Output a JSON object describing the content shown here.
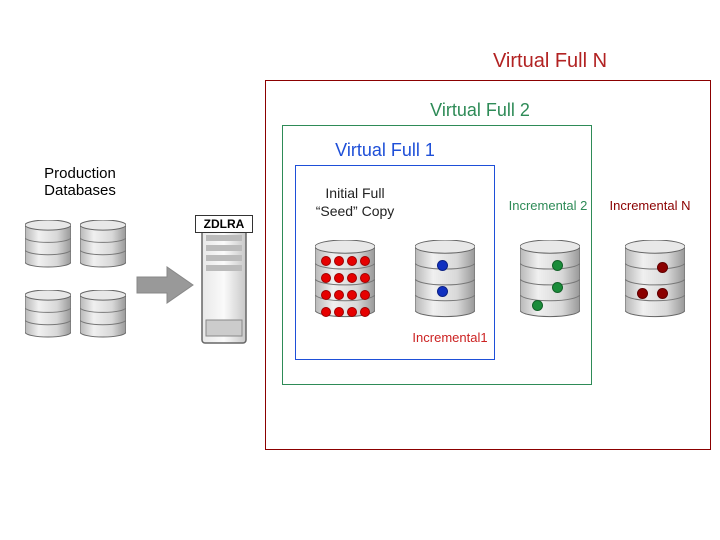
{
  "labels": {
    "production": "Production\nDatabases",
    "zdlra": "ZDLRA",
    "virtualN": "Virtual Full N",
    "virtual2": "Virtual Full 2",
    "virtual1": "Virtual Full 1",
    "seed1": "Initial Full",
    "seed2": "“Seed” Copy",
    "inc1": "Incremental1",
    "inc2": "Incremental 2",
    "incN": "Incremental N"
  },
  "colors": {
    "virtualN_border": "#8b0000",
    "virtualN_text": "#b22222",
    "virtual2": "#2e8b57",
    "virtual1": "#1e4fd8",
    "inc1": "#cc2222",
    "inc2": "#2e8b57",
    "incN": "#8b0000",
    "seed_dot": "#e60000",
    "inc1_dot": "#1030c0",
    "inc2_dot": "#1a8c3a",
    "incN_dot": "#8b0000"
  }
}
